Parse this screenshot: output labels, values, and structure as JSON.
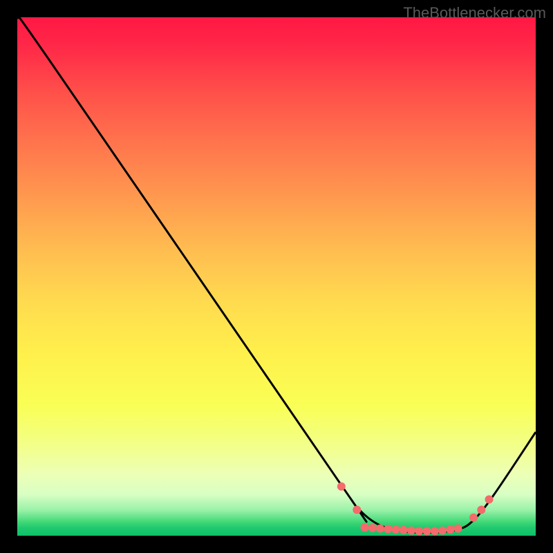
{
  "watermark": "TheBottlenecker.com",
  "chart_data": {
    "type": "line",
    "title": "",
    "xlabel": "",
    "ylabel": "",
    "xlim": [
      0,
      100
    ],
    "ylim": [
      0,
      100
    ],
    "background_gradient_stops": [
      {
        "offset": 0.0,
        "color": "#ff1744"
      },
      {
        "offset": 0.06,
        "color": "#ff2a48"
      },
      {
        "offset": 0.15,
        "color": "#ff524a"
      },
      {
        "offset": 0.25,
        "color": "#ff774d"
      },
      {
        "offset": 0.35,
        "color": "#ff9a4f"
      },
      {
        "offset": 0.45,
        "color": "#ffbd50"
      },
      {
        "offset": 0.55,
        "color": "#ffdb4f"
      },
      {
        "offset": 0.65,
        "color": "#fff04c"
      },
      {
        "offset": 0.75,
        "color": "#f9ff56"
      },
      {
        "offset": 0.82,
        "color": "#f3ff84"
      },
      {
        "offset": 0.88,
        "color": "#edffb5"
      },
      {
        "offset": 0.92,
        "color": "#d9ffc4"
      },
      {
        "offset": 0.95,
        "color": "#9bf2a9"
      },
      {
        "offset": 0.974,
        "color": "#3fd876"
      },
      {
        "offset": 0.985,
        "color": "#1fc96e"
      },
      {
        "offset": 1.0,
        "color": "#0dc168"
      }
    ],
    "series": [
      {
        "name": "curve",
        "points": [
          {
            "x": 0,
            "y": 100
          },
          {
            "x": 6,
            "y": 92
          },
          {
            "x": 62,
            "y": 10.5
          },
          {
            "x": 66,
            "y": 5
          },
          {
            "x": 70,
            "y": 2
          },
          {
            "x": 75,
            "y": 0.8
          },
          {
            "x": 80,
            "y": 0.6
          },
          {
            "x": 85,
            "y": 1.2
          },
          {
            "x": 88,
            "y": 3
          },
          {
            "x": 92,
            "y": 8
          },
          {
            "x": 100,
            "y": 20
          }
        ]
      }
    ],
    "markers": [
      {
        "x": 62.5,
        "y": 9.5
      },
      {
        "x": 65.5,
        "y": 5.0
      },
      {
        "x": 67.0,
        "y": 1.6
      },
      {
        "x": 68.5,
        "y": 1.5
      },
      {
        "x": 70.0,
        "y": 1.4
      },
      {
        "x": 71.5,
        "y": 1.3
      },
      {
        "x": 73.0,
        "y": 1.2
      },
      {
        "x": 74.5,
        "y": 1.1
      },
      {
        "x": 76.0,
        "y": 1.0
      },
      {
        "x": 77.5,
        "y": 0.9
      },
      {
        "x": 79.0,
        "y": 0.9
      },
      {
        "x": 80.5,
        "y": 0.9
      },
      {
        "x": 82.0,
        "y": 1.0
      },
      {
        "x": 83.5,
        "y": 1.2
      },
      {
        "x": 85.0,
        "y": 1.4
      },
      {
        "x": 88.0,
        "y": 3.5
      },
      {
        "x": 89.5,
        "y": 5.0
      },
      {
        "x": 91.0,
        "y": 7.0
      }
    ],
    "marker_color": "#f36b6b",
    "line_color": "#000000"
  }
}
